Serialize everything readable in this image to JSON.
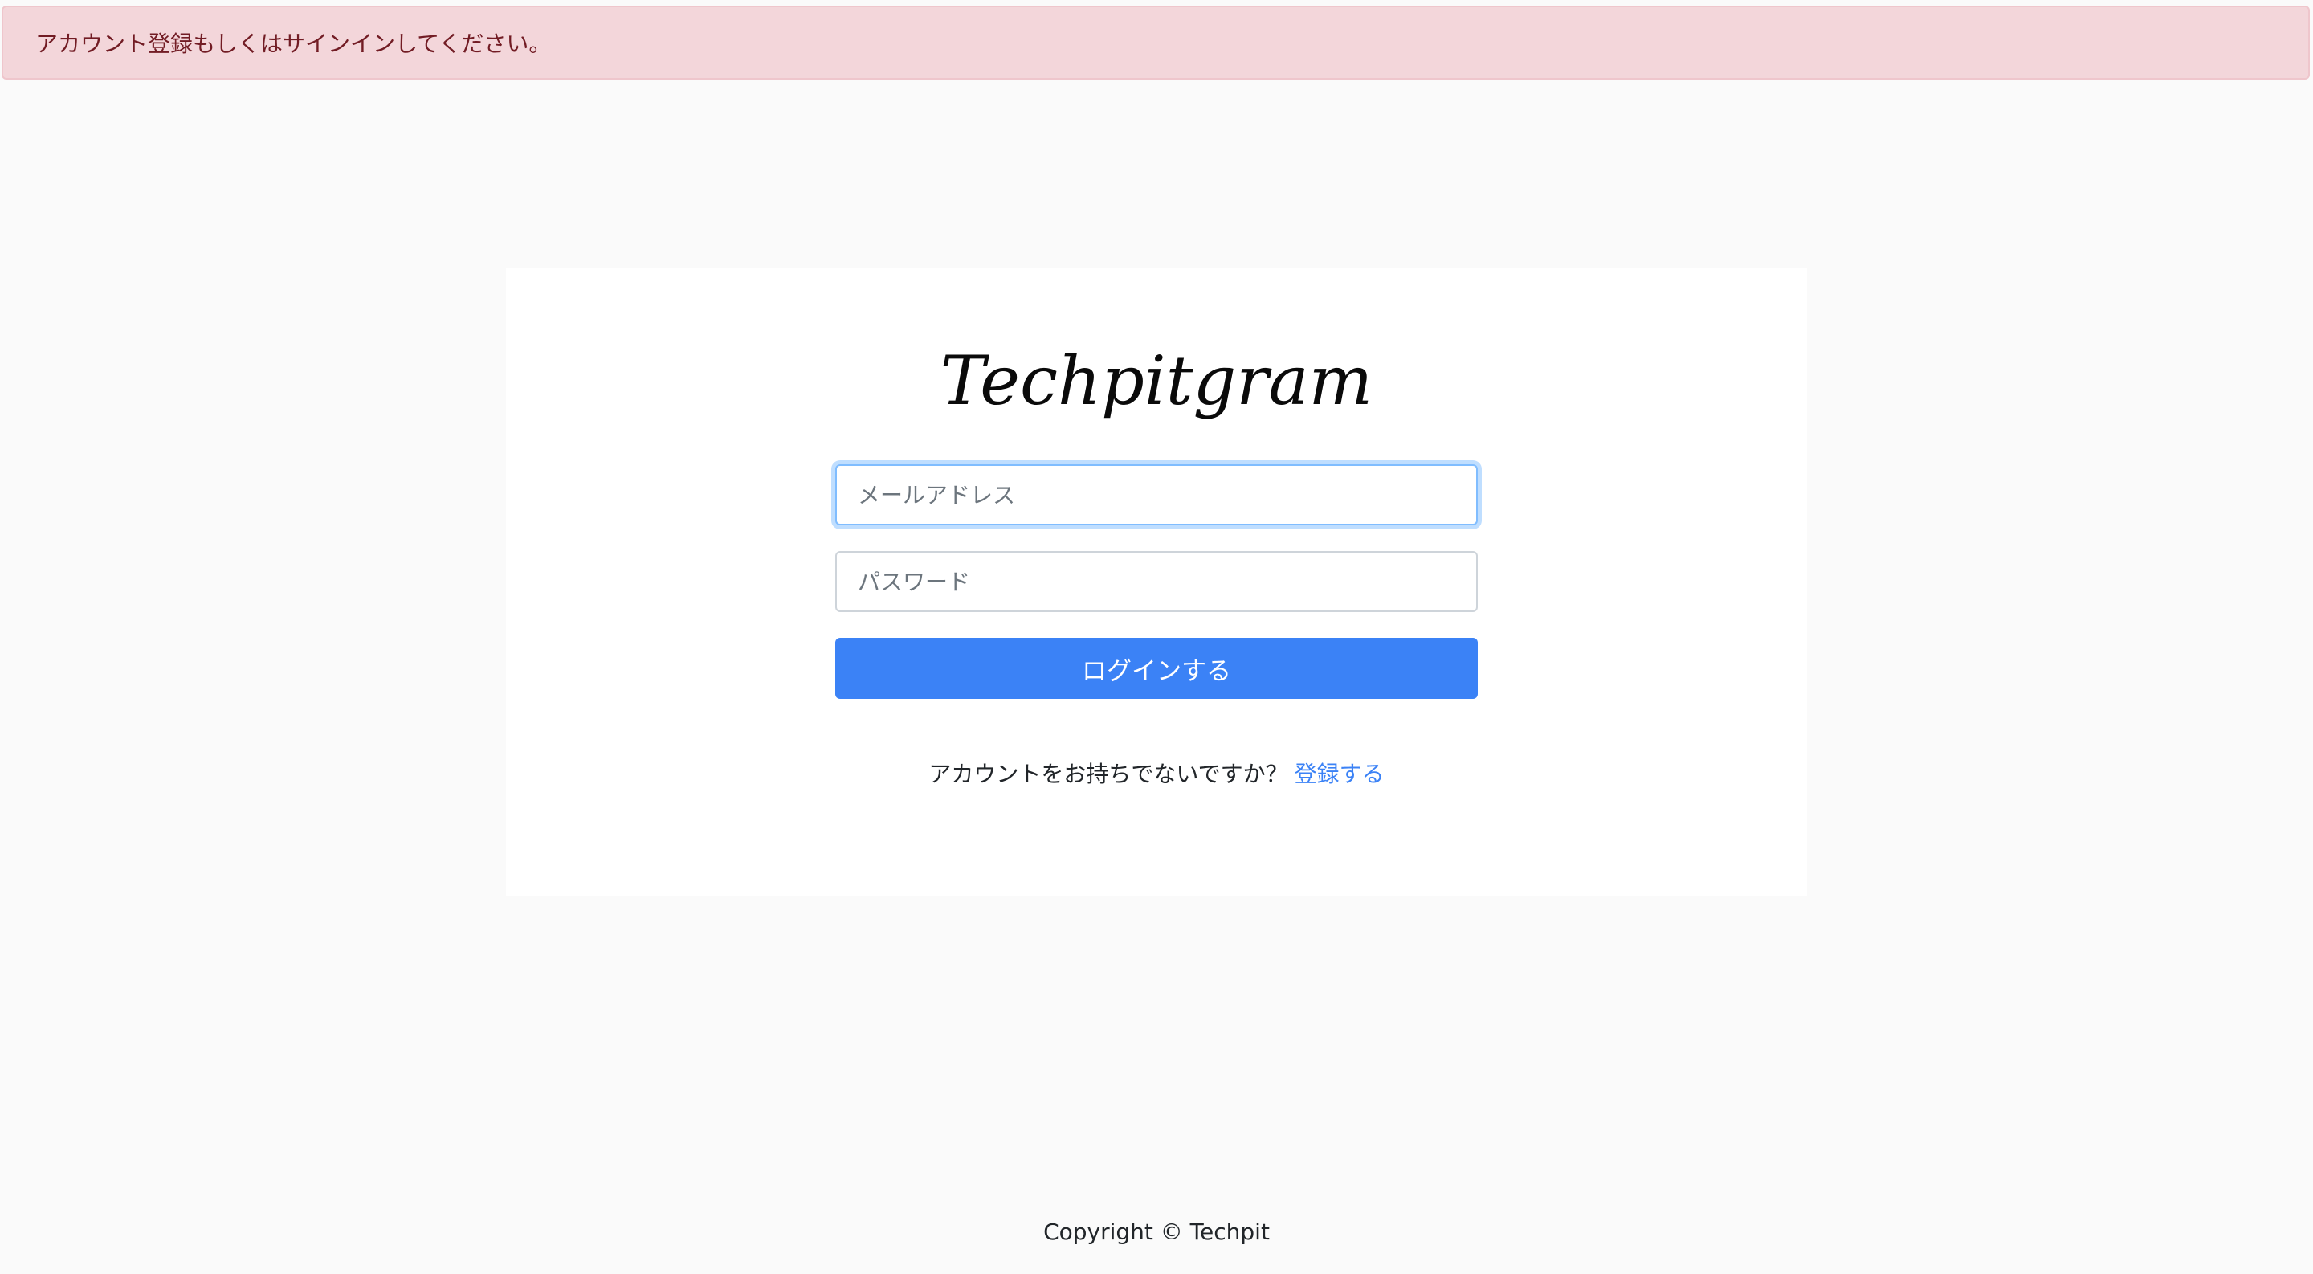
{
  "alert": {
    "message": "アカウント登録もしくはサインインしてください。"
  },
  "login_card": {
    "logo_text": "Techpitgram",
    "email_placeholder": "メールアドレス",
    "password_placeholder": "パスワード",
    "login_button_label": "ログインする",
    "signup_prompt": "アカウントをお持ちでないですか？",
    "signup_link_label": "登録する"
  },
  "footer": {
    "copyright": "Copyright © Techpit"
  },
  "colors": {
    "alert_background": "#f3d6da",
    "alert_text": "#721c24",
    "primary": "#3b82f6",
    "page_background": "#fafafa"
  }
}
